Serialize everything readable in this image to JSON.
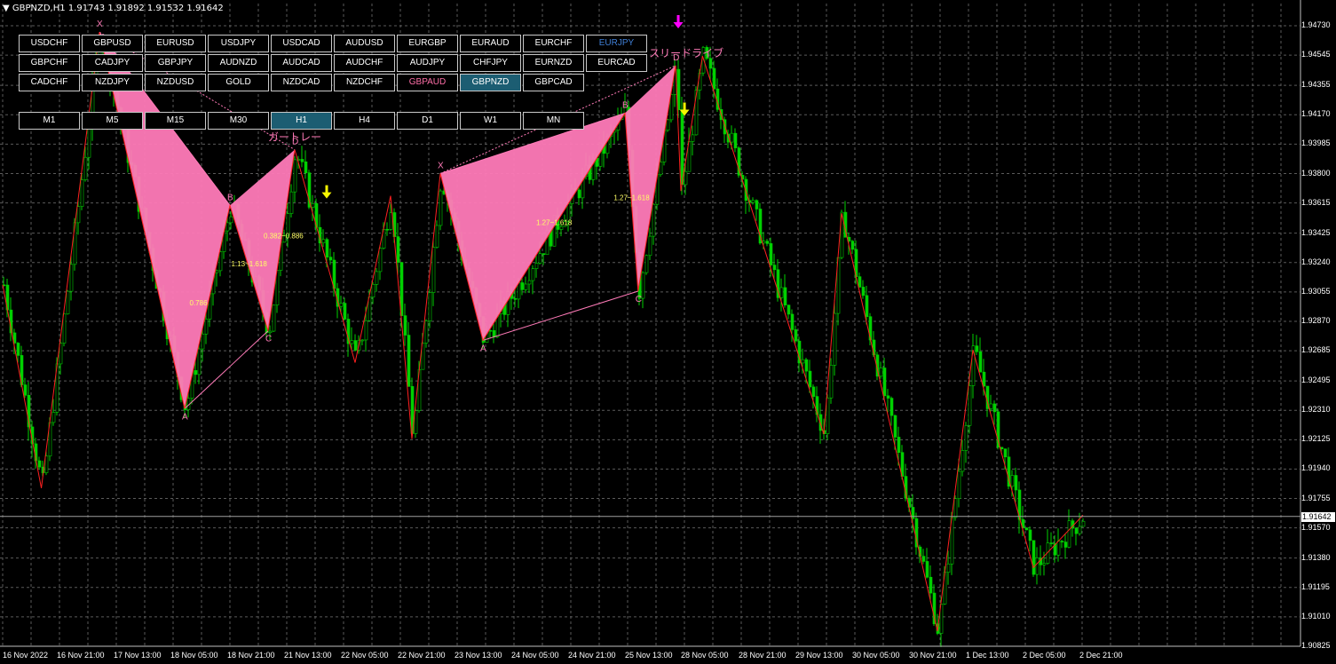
{
  "header": {
    "symbol": "GBPNZD,H1",
    "ohlc": "1.91743 1.91892 1.91532 1.91642"
  },
  "symbol_rows": [
    [
      "USDCHF",
      "GBPUSD",
      "EURUSD",
      "USDJPY",
      "USDCAD",
      "AUDUSD",
      "EURGBP",
      "EURAUD",
      "EURCHF",
      "EURJPY"
    ],
    [
      "GBPCHF",
      "CADJPY",
      "GBPJPY",
      "AUDNZD",
      "AUDCAD",
      "AUDCHF",
      "AUDJPY",
      "CHFJPY",
      "EURNZD",
      "EURCAD"
    ],
    [
      "CADCHF",
      "NZDJPY",
      "NZDUSD",
      "GOLD",
      "NZDCAD",
      "NZDCHF",
      "GBPAUD",
      "GBPNZD",
      "GBPCAD"
    ]
  ],
  "timeframes": [
    "M1",
    "M5",
    "M15",
    "M30",
    "H1",
    "H4",
    "D1",
    "W1",
    "MN"
  ],
  "active_symbol": "GBPNZD",
  "active_timeframe": "H1",
  "colors": {
    "candle": "#00d000",
    "zigzag": "#ff2020",
    "pattern": "#ff7ab8",
    "arrow_yellow": "#f5f500",
    "arrow_magenta": "#ff00ff",
    "ratio": "#ffff66"
  },
  "chart_data": {
    "type": "candlestick",
    "title": "GBPNZD,H1",
    "ylim": [
      1.90825,
      1.9487
    ],
    "y_ticks": [
      "1.94730",
      "1.94545",
      "1.94355",
      "1.94170",
      "1.93985",
      "1.93800",
      "1.93615",
      "1.93425",
      "1.93240",
      "1.93055",
      "1.92870",
      "1.92685",
      "1.92495",
      "1.92310",
      "1.92125",
      "1.91940",
      "1.91755",
      "1.91570",
      "1.91380",
      "1.91195",
      "1.91010",
      "1.90825"
    ],
    "current_price": "1.91642",
    "x_ticks": [
      "16 Nov 2022",
      "16 Nov 21:00",
      "17 Nov 13:00",
      "18 Nov 05:00",
      "18 Nov 21:00",
      "21 Nov 13:00",
      "22 Nov 05:00",
      "22 Nov 21:00",
      "23 Nov 13:00",
      "24 Nov 05:00",
      "24 Nov 21:00",
      "25 Nov 13:00",
      "28 Nov 05:00",
      "28 Nov 21:00",
      "29 Nov 13:00",
      "30 Nov 05:00",
      "30 Nov 21:00",
      "1 Dec 13:00",
      "2 Dec 05:00",
      "2 Dec 21:00"
    ],
    "zigzag": [
      [
        "16 Nov 2022",
        1.931
      ],
      [
        "16 Nov 15:00",
        1.9182
      ],
      [
        "17 Nov 09:00",
        1.9469
      ],
      [
        "18 Nov 09:00",
        1.9232
      ],
      [
        "19 Nov 00:00",
        1.936
      ],
      [
        "20 Nov 19:00",
        1.9281
      ],
      [
        "21 Nov 16:00",
        1.9395
      ],
      [
        "22 Nov 09:00",
        1.9261
      ],
      [
        "22 Nov 19:00",
        1.9366
      ],
      [
        "23 Nov 01:00",
        1.9213
      ],
      [
        "23 Nov 09:00",
        1.938
      ],
      [
        "23 Nov 21:00",
        1.9275
      ],
      [
        "25 Nov 13:00",
        1.9418
      ],
      [
        "26 Nov 04:00",
        1.9306
      ],
      [
        "27 Nov 23:00",
        1.9448
      ],
      [
        "28 Nov 05:00",
        1.9369
      ],
      [
        "28 Nov 11:00",
        1.9454
      ],
      [
        "29 Nov 21:00",
        1.9216
      ],
      [
        "30 Nov 02:00",
        1.9355
      ],
      [
        "1 Dec 05:00",
        1.9092
      ],
      [
        "1 Dec 15:00",
        1.9269
      ],
      [
        "2 Dec 08:00",
        1.9132
      ],
      [
        "2 Dec 22:00",
        1.9165
      ]
    ],
    "patterns": [
      {
        "name": "ガートレー",
        "points": [
          [
            "X",
            "17 Nov 09:00",
            1.9469
          ],
          [
            "A",
            "18 Nov 09:00",
            1.9232
          ],
          [
            "B",
            "19 Nov 00:00",
            1.936
          ],
          [
            "C",
            "20 Nov 19:00",
            1.9281
          ],
          [
            "D",
            "21 Nov 16:00",
            1.9395
          ]
        ],
        "ratios": [
          "0.786",
          "1.13~1.618",
          "0.382~0.886"
        ]
      },
      {
        "name": "スリードライブ",
        "points": [
          [
            "X",
            "23 Nov 09:00",
            1.938
          ],
          [
            "A",
            "23 Nov 21:00",
            1.9275
          ],
          [
            "B",
            "25 Nov 13:00",
            1.9418
          ],
          [
            "C",
            "26 Nov 04:00",
            1.9306
          ],
          [
            "D",
            "27 Nov 23:00",
            1.9448
          ]
        ],
        "ratios": [
          "1.27~1.618",
          "1.27~1.618"
        ]
      }
    ],
    "signals": [
      {
        "type": "sell",
        "color": "yellow",
        "time": "22 Nov 01:00",
        "price": 1.9366
      },
      {
        "type": "sell",
        "color": "yellow",
        "time": "28 Nov 06:00",
        "price": 1.9418
      },
      {
        "type": "sell",
        "color": "magenta",
        "time": "28 Nov 02:00",
        "price": 1.9473
      }
    ],
    "grid": true
  }
}
